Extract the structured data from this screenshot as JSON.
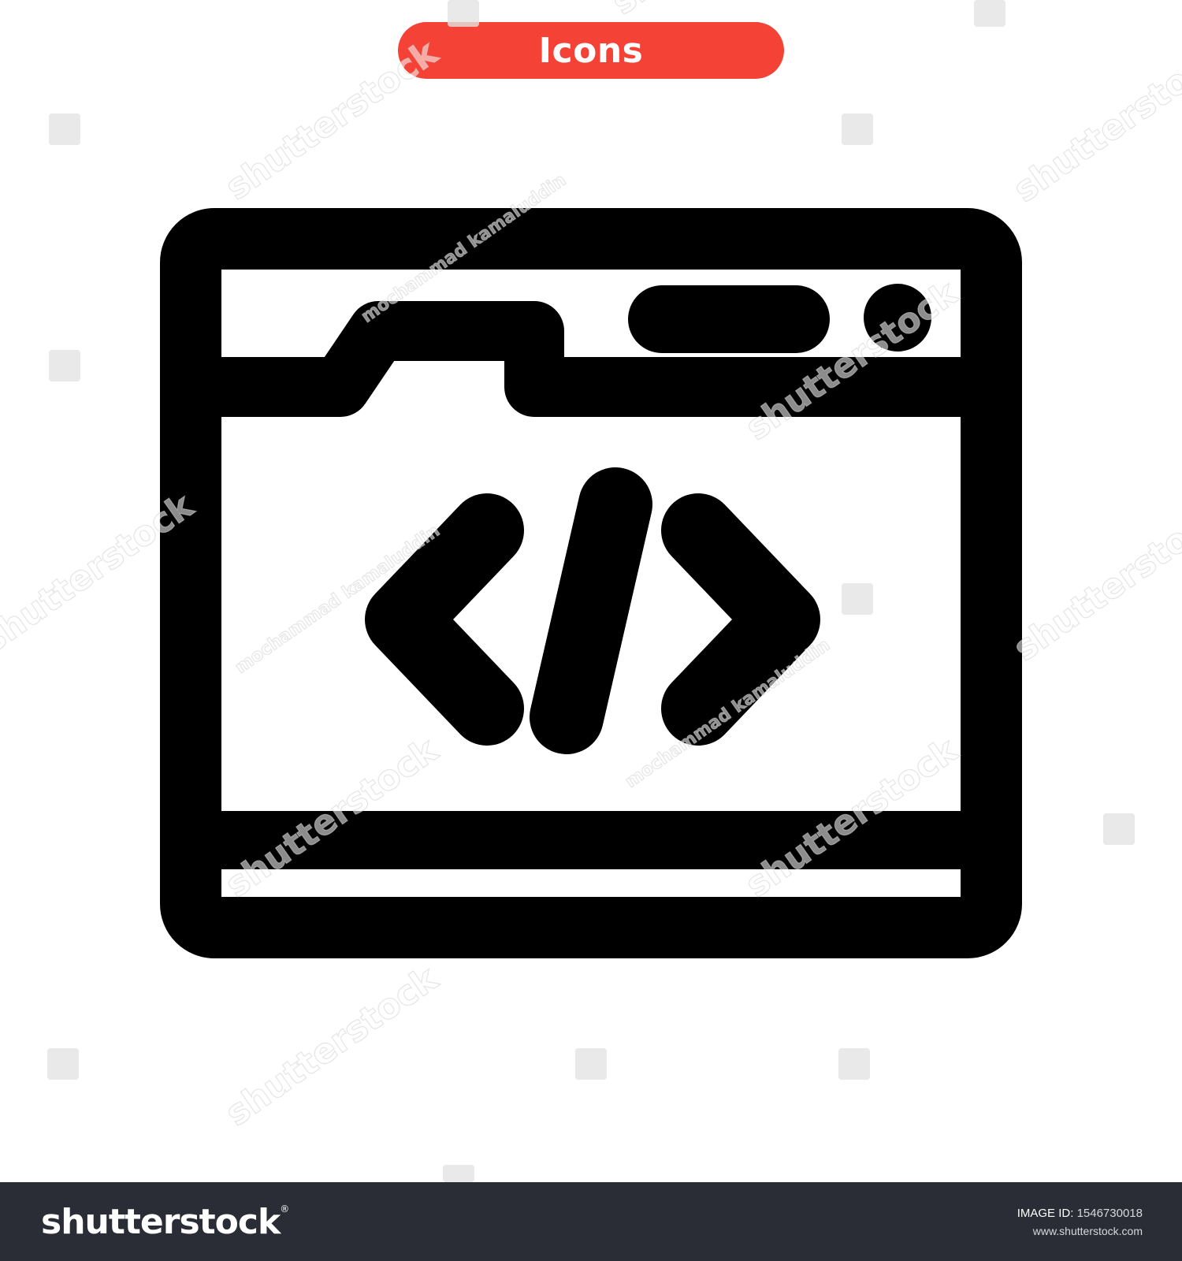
{
  "badge": {
    "label": "Icons"
  },
  "watermark": {
    "brand": "shutterstock",
    "author": "mochammad kamaluddin"
  },
  "footer": {
    "logo_text": "shutterstock",
    "logo_mark": "®",
    "image_id_label": "IMAGE ID:",
    "image_id_value": "1546730018",
    "site": "www.shutterstock.com"
  },
  "icons": {
    "main": "web-code-browser-icon"
  },
  "colors": {
    "badge": "#f44336",
    "icon": "#000000",
    "footer_bg": "#2a2d36",
    "background": "#ffffff"
  }
}
